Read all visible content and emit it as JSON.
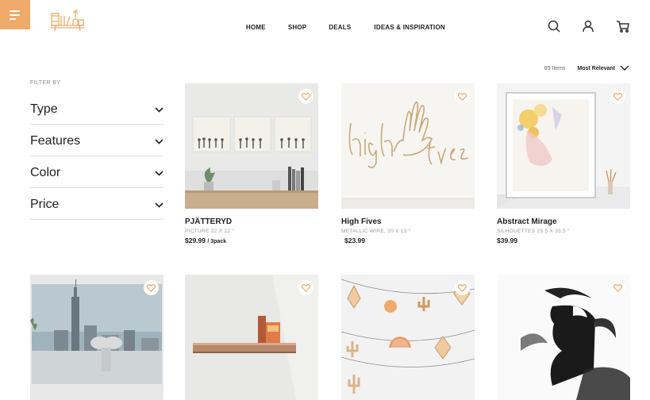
{
  "header": {
    "nav": [
      "HOME",
      "SHOP",
      "DEALS",
      "IDEAS & INSPIRATION"
    ],
    "icons": [
      "search-icon",
      "account-icon",
      "cart-icon"
    ]
  },
  "listing": {
    "count": "85 Items",
    "sort": "Most Relevant"
  },
  "filters": {
    "label": "FILTER BY",
    "items": [
      "Type",
      "Features",
      "Color",
      "Price"
    ]
  },
  "products": [
    {
      "name": "PJÄTTERYD",
      "desc": "PICTURE 22 X 22 \"",
      "price": "$29.99",
      "unit": "/ 3pack"
    },
    {
      "name": "High Fives",
      "desc": "METALLIC WIRE, 20 X 13 \"",
      "price": "$23.99",
      "unit": ""
    },
    {
      "name": "Abstract Mirage",
      "desc": "SILHOUETTES 25.5 X 33.5 \"",
      "price": "$39.99",
      "unit": ""
    },
    {
      "name": "",
      "desc": "",
      "price": "",
      "unit": ""
    },
    {
      "name": "",
      "desc": "",
      "price": "",
      "unit": ""
    },
    {
      "name": "",
      "desc": "",
      "price": "",
      "unit": ""
    },
    {
      "name": "",
      "desc": "",
      "price": "",
      "unit": ""
    }
  ],
  "colors": {
    "accent": "#efaa6a",
    "text": "#222222",
    "muted": "#999999"
  }
}
